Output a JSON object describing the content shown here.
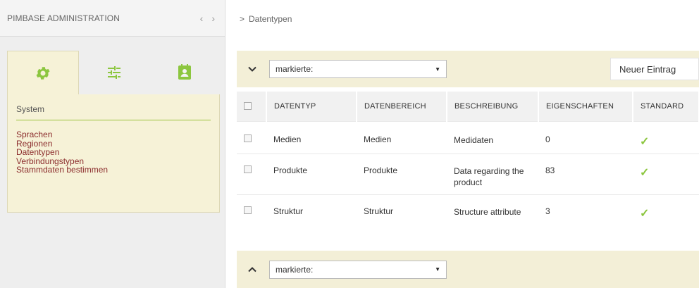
{
  "sidebar": {
    "title": "PIMBASE ADMINISTRATION",
    "prev_icon": "chevron-left-icon",
    "next_icon": "chevron-right-icon",
    "tabs": [
      {
        "icon": "gear-icon",
        "active": true
      },
      {
        "icon": "sliders-icon",
        "active": false
      },
      {
        "icon": "contact-book-icon",
        "active": false
      }
    ],
    "panel": {
      "heading": "System",
      "links": [
        "Sprachen",
        "Regionen",
        "Datentypen",
        "Verbindungstypen",
        "Stammdaten bestimmen"
      ]
    },
    "colors": {
      "accent": "#8cc63f",
      "panel_bg": "#f6f2d7",
      "link": "#8b2c2c"
    }
  },
  "breadcrumb": {
    "separator": ">",
    "current": "Datentypen"
  },
  "toolbar_top": {
    "select_value": "markierte:",
    "new_entry_label": "Neuer Eintrag"
  },
  "toolbar_bottom": {
    "select_value": "markierte:"
  },
  "table": {
    "headers": [
      "DATENTYP",
      "DATENBEREICH",
      "BESCHREIBUNG",
      "EIGENSCHAFTEN",
      "STANDARD"
    ],
    "rows": [
      {
        "datentyp": "Medien",
        "datenbereich": "Medien",
        "beschreibung": "Medidaten",
        "eigenschaften": "0",
        "standard": "✓"
      },
      {
        "datentyp": "Produkte",
        "datenbereich": "Produkte",
        "beschreibung": "Data regarding the product",
        "eigenschaften": "83",
        "standard": "✓"
      },
      {
        "datentyp": "Struktur",
        "datenbereich": "Struktur",
        "beschreibung": "Structure attribute",
        "eigenschaften": "3",
        "standard": "✓"
      }
    ]
  }
}
